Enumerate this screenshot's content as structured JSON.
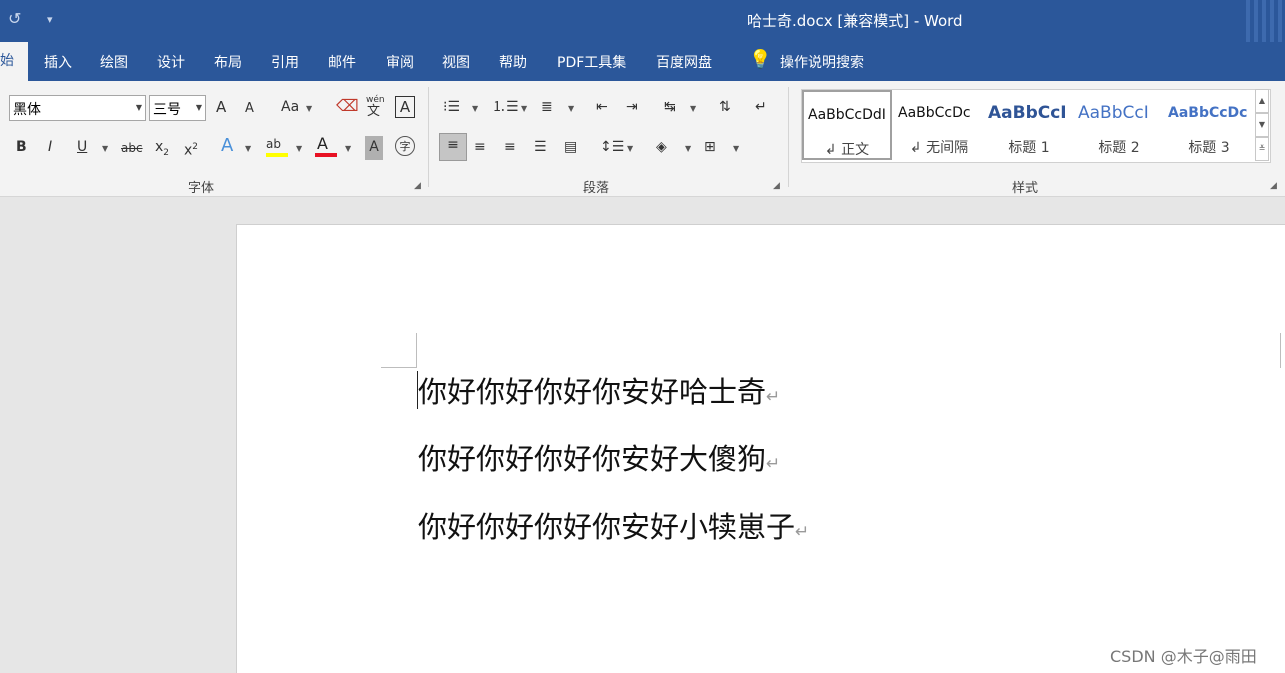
{
  "window": {
    "title": "哈士奇.docx [兼容模式]  -  Word"
  },
  "quick_access": {
    "undo_icon": "undo-icon",
    "customize_icon": "customize-dropdown-icon"
  },
  "tabs": [
    {
      "label": "始",
      "active": true
    },
    {
      "label": "插入"
    },
    {
      "label": "绘图"
    },
    {
      "label": "设计"
    },
    {
      "label": "布局"
    },
    {
      "label": "引用"
    },
    {
      "label": "邮件"
    },
    {
      "label": "审阅"
    },
    {
      "label": "视图"
    },
    {
      "label": "帮助"
    },
    {
      "label": "PDF工具集"
    },
    {
      "label": "百度网盘"
    }
  ],
  "tell_me": {
    "label": "操作说明搜索",
    "icon": "lightbulb-icon"
  },
  "font_group": {
    "label": "字体",
    "font_name": "黑体",
    "font_size": "三号",
    "grow_font": "A",
    "shrink_font": "A",
    "change_case": "Aa",
    "phonetic": "wén",
    "phonetic_char": "文",
    "char_border": "A",
    "bold": "B",
    "italic": "I",
    "underline": "U",
    "strike": "abc",
    "subscript": "x",
    "sub_mark": "2",
    "superscript": "x",
    "sup_mark": "2",
    "text_effects": "A",
    "highlight": "ab",
    "font_color": "A",
    "char_shading": "A",
    "enclose": "字",
    "highlight_color": "#ffff00",
    "font_color_value": "#e81123"
  },
  "paragraph_group": {
    "label": "段落"
  },
  "styles_group": {
    "label": "样式",
    "styles": [
      {
        "sample": "AaBbCcDdI",
        "name": "↲ 正文",
        "active": true
      },
      {
        "sample": "AaBbCcDc",
        "name": "↲ 无间隔"
      },
      {
        "sample": "AaBbCcI",
        "name": "标题 1"
      },
      {
        "sample": "AaBbCcI",
        "name": "标题 2"
      },
      {
        "sample": "AaBbCcDc",
        "name": "标题 3"
      }
    ]
  },
  "document": {
    "lines": [
      "你好你好你好你安好哈士奇",
      "你好你好你好你安好大傻狗",
      "你好你好你好你安好小犊崽子"
    ],
    "paragraph_mark": "↵"
  },
  "watermark": "CSDN @木子@雨田"
}
